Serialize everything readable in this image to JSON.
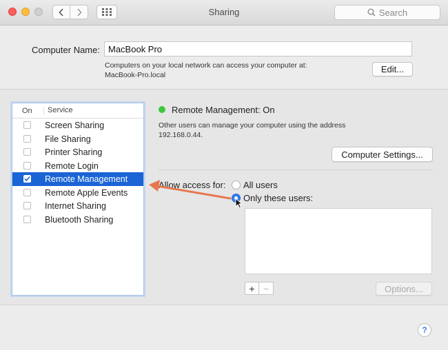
{
  "window": {
    "title": "Sharing"
  },
  "toolbar": {
    "back_icon": "chevron-left-icon",
    "forward_icon": "chevron-right-icon",
    "grid_icon": "grid-icon",
    "search_placeholder": "Search"
  },
  "computer_name": {
    "label": "Computer Name:",
    "value": "MacBook Pro",
    "help_line1": "Computers on your local network can access your computer at:",
    "help_line2": "MacBook-Pro.local",
    "edit_label": "Edit..."
  },
  "service_list": {
    "header_on": "On",
    "header_service": "Service",
    "items": [
      {
        "label": "Screen Sharing",
        "checked": false
      },
      {
        "label": "File Sharing",
        "checked": false
      },
      {
        "label": "Printer Sharing",
        "checked": false
      },
      {
        "label": "Remote Login",
        "checked": false
      },
      {
        "label": "Remote Management",
        "checked": true,
        "selected": true
      },
      {
        "label": "Remote Apple Events",
        "checked": false
      },
      {
        "label": "Internet Sharing",
        "checked": false
      },
      {
        "label": "Bluetooth Sharing",
        "checked": false
      }
    ]
  },
  "detail": {
    "status_color": "#3cc83c",
    "status_text": "Remote Management: On",
    "description_line1": "Other users can manage your computer using the address",
    "description_line2": "192.168.0.44.",
    "computer_settings_label": "Computer Settings...",
    "allow_access_label": "Allow access for:",
    "option_all_users": "All users",
    "option_only_these": "Only these users:",
    "selected_option": "Only these users:",
    "plus_label": "+",
    "minus_label": "−",
    "options_label": "Options..."
  },
  "annotation": {
    "arrow_color": "#e8774f"
  },
  "help": {
    "label": "?"
  },
  "colors": {
    "selection": "#1a64d6",
    "accent": "#2f7ff2"
  }
}
